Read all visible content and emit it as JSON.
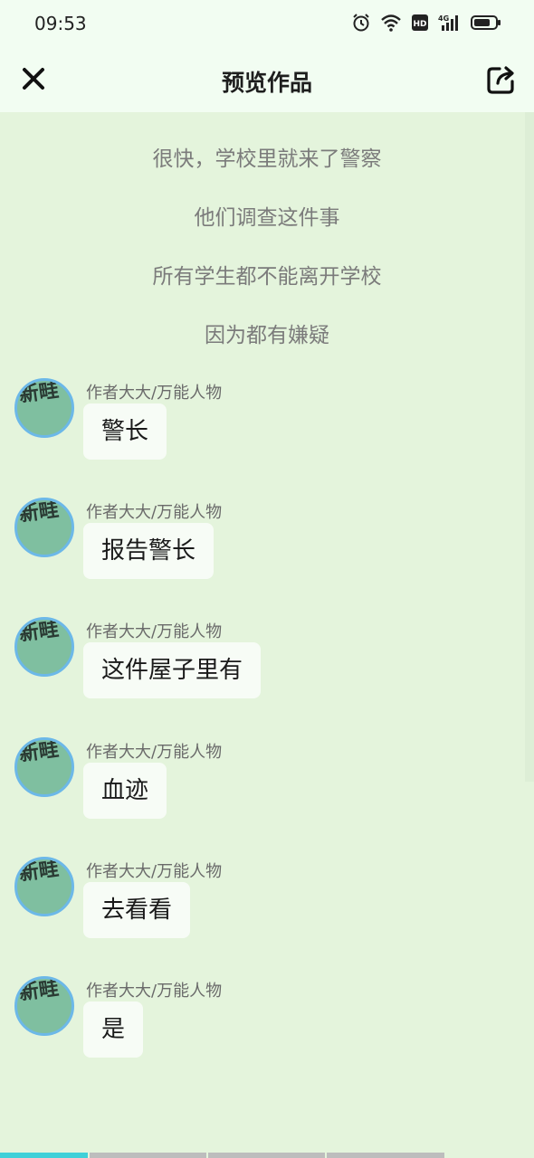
{
  "status_bar": {
    "time": "09:53",
    "icons": [
      "alarm-icon",
      "wifi-icon",
      "hd-icon",
      "signal-4g-icon",
      "battery-icon"
    ]
  },
  "header": {
    "title": "预览作品",
    "close_icon": "close-icon",
    "share_icon": "share-icon"
  },
  "narration": [
    "很快，学校里就来了警察",
    "他们调查这件事",
    "所有学生都不能离开学校",
    "因为都有嫌疑"
  ],
  "messages": [
    {
      "speaker": "作者大大/万能人物",
      "text": "警长",
      "avatar": "新畦"
    },
    {
      "speaker": "作者大大/万能人物",
      "text": "报告警长",
      "avatar": "新畦"
    },
    {
      "speaker": "作者大大/万能人物",
      "text": "这件屋子里有",
      "avatar": "新畦"
    },
    {
      "speaker": "作者大大/万能人物",
      "text": "血迹",
      "avatar": "新畦"
    },
    {
      "speaker": "作者大大/万能人物",
      "text": "去看看",
      "avatar": "新畦"
    },
    {
      "speaker": "作者大大/万能人物",
      "text": "是",
      "avatar": "新畦"
    }
  ],
  "colors": {
    "background": "#e4f4dc",
    "header": "#f2fdf2",
    "bubble": "#f7fcf6",
    "progress_active": "#3fd0d8",
    "progress_inactive": "#bdbdbd"
  }
}
